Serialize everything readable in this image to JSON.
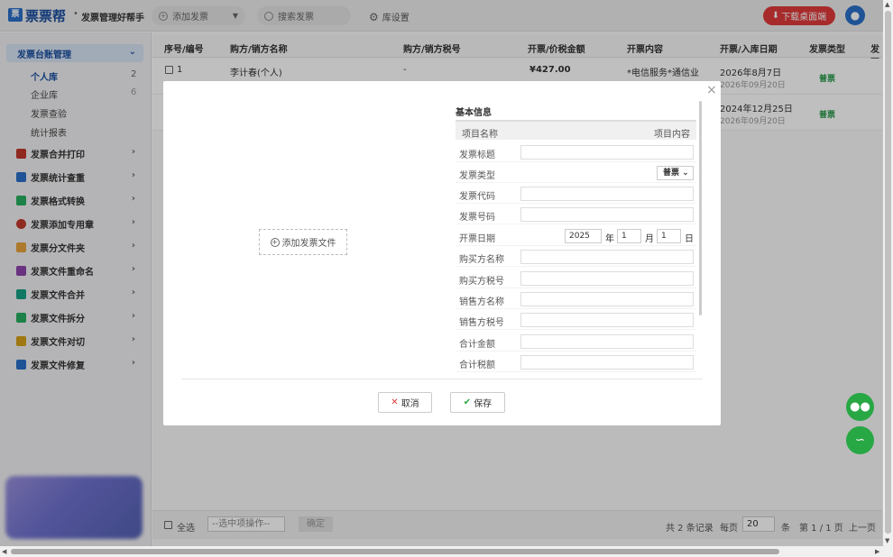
{
  "topbar": {
    "logo_mark": "票",
    "app_name": "票票帮",
    "separator": "•",
    "slogan": "发票管理好帮手",
    "add_invoice": "添加发票",
    "search_placeholder": "搜索发票",
    "settings": "库设置",
    "download": "下载桌面端"
  },
  "sidebar": {
    "active_group": "发票台账管理",
    "sub_items": [
      {
        "label": "个人库",
        "count": "2"
      },
      {
        "label": "企业库",
        "count": "6"
      },
      {
        "label": "发票查验",
        "count": ""
      },
      {
        "label": "统计报表",
        "count": ""
      }
    ],
    "items": [
      {
        "label": "发票合并打印",
        "color": "#c0392b"
      },
      {
        "label": "发票统计查重",
        "color": "#2a6fc9"
      },
      {
        "label": "发票格式转换",
        "color": "#27ae60"
      },
      {
        "label": "发票添加专用章",
        "color": "#c0392b"
      },
      {
        "label": "发票分文件夹",
        "color": "#e6a23c"
      },
      {
        "label": "发票文件重命名",
        "color": "#8e44ad"
      },
      {
        "label": "发票文件合并",
        "color": "#16a085"
      },
      {
        "label": "发票文件拆分",
        "color": "#27ae60"
      },
      {
        "label": "发票文件对切",
        "color": "#d4a017"
      },
      {
        "label": "发票文件修复",
        "color": "#2a6fc9"
      }
    ]
  },
  "table": {
    "headers": [
      "序号/编号",
      "购方/销方名称",
      "购方/销方税号",
      "开票/价税金额",
      "开票内容",
      "开票/入库日期",
      "发票类型",
      "发票"
    ],
    "rows": [
      {
        "no": "1",
        "name": "李计春(个人)",
        "tax_id": "-",
        "amount": "¥427.00",
        "content": "*电信服务*通信业",
        "date": "2026年8月7日",
        "date2": "2026年09月20日",
        "type": "普票"
      },
      {
        "no": "",
        "name": "",
        "tax_id": "",
        "amount": "",
        "content": "",
        "date": "2024年12月25日",
        "date2": "2026年09月20日",
        "type": "普票"
      }
    ]
  },
  "footer": {
    "select_all": "全选",
    "bulk_action": "--选中项操作--",
    "confirm": "确定",
    "total": "共 2 条记录",
    "per_page_label": "每页",
    "per_page": "20",
    "unit": "条",
    "page_info": "第 1 / 1 页",
    "prev": "上一页"
  },
  "modal": {
    "add_file": "添加发票文件",
    "section_title": "基本信息",
    "col_name": "项目名称",
    "col_content": "项目内容",
    "fields": {
      "title": "发票标题",
      "type": "发票类型",
      "code": "发票代码",
      "number": "发票号码",
      "date": "开票日期",
      "buyer_name": "购买方名称",
      "buyer_tax": "购买方税号",
      "seller_name": "销售方名称",
      "seller_tax": "销售方税号",
      "total": "合计金额",
      "tax_total": "合计税额"
    },
    "type_value": "普票",
    "date_year": "2025",
    "date_month": "1",
    "date_day": "1",
    "year_unit": "年",
    "month_unit": "月",
    "day_unit": "日",
    "cancel": "取消",
    "save": "保存"
  }
}
